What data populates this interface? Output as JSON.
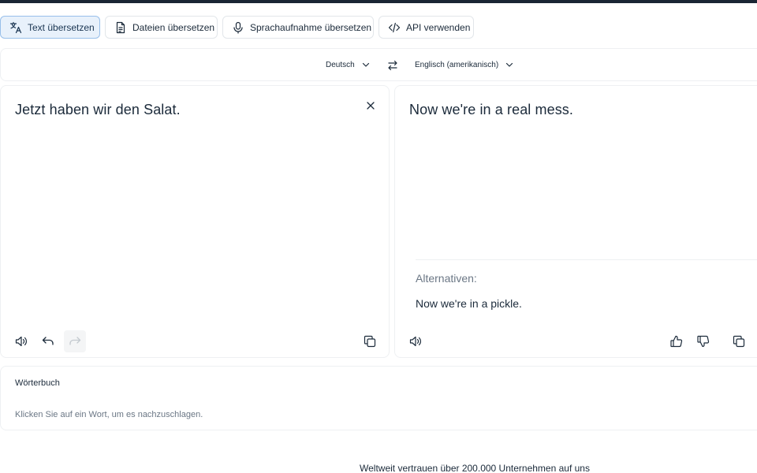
{
  "tabs": [
    {
      "label": "Text übersetzen",
      "icon": "translate-icon",
      "active": true
    },
    {
      "label": "Dateien übersetzen",
      "icon": "document-icon",
      "active": false
    },
    {
      "label": "Sprachaufnahme übersetzen",
      "icon": "microphone-icon",
      "active": false
    },
    {
      "label": "API verwenden",
      "icon": "code-icon",
      "active": false
    }
  ],
  "languages": {
    "source": "Deutsch",
    "target": "Englisch (amerikanisch)"
  },
  "source_panel": {
    "text": "Jetzt haben wir den Salat."
  },
  "target_panel": {
    "text": "Now we're in a real mess.",
    "alternatives_label": "Alternativen:",
    "alternatives": [
      "Now we're in a pickle."
    ]
  },
  "dictionary": {
    "title": "Wörterbuch",
    "hint": "Klicken Sie auf ein Wort, um es nachzuschlagen."
  },
  "footer": {
    "text": "Weltweit vertrauen über 200.000 Unternehmen auf uns"
  },
  "colors": {
    "active_tab_bg": "#e8f1fb",
    "active_tab_border": "#98bfea",
    "text_primary": "#1b2a3a",
    "text_muted": "#6b7785",
    "top_bar": "#1a2634"
  }
}
